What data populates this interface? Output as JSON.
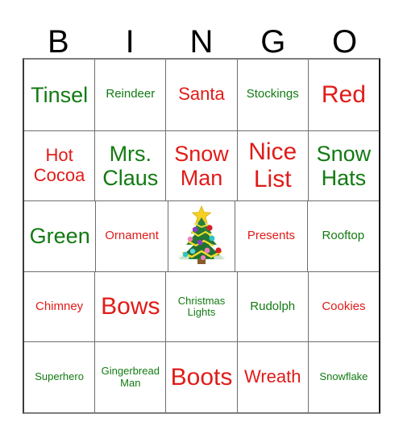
{
  "card": {
    "title": "BINGO",
    "headers": [
      "B",
      "I",
      "N",
      "G",
      "O"
    ],
    "header_color": "#000000",
    "grid_border_color": "#6e6e6e",
    "background_color": "#ffffff",
    "text_colors": {
      "green": "#127a12",
      "red": "#e01b18"
    },
    "rows": [
      [
        {
          "label": "Tinsel",
          "color": "green",
          "size": "lg"
        },
        {
          "label": "Reindeer",
          "color": "green",
          "size": "sm"
        },
        {
          "label": "Santa",
          "color": "red",
          "size": "md"
        },
        {
          "label": "Stockings",
          "color": "green",
          "size": "sm"
        },
        {
          "label": "Red",
          "color": "red",
          "size": "xl"
        }
      ],
      [
        {
          "label": "Hot\nCocoa",
          "color": "red",
          "size": "md"
        },
        {
          "label": "Mrs.\nClaus",
          "color": "green",
          "size": "lg"
        },
        {
          "label": "Snow\nMan",
          "color": "red",
          "size": "lg"
        },
        {
          "label": "Nice\nList",
          "color": "red",
          "size": "xl"
        },
        {
          "label": "Snow\nHats",
          "color": "green",
          "size": "lg"
        }
      ],
      [
        {
          "label": "Green",
          "color": "green",
          "size": "lg"
        },
        {
          "label": "Ornament",
          "color": "red",
          "size": "sm"
        },
        {
          "label": "",
          "color": "green",
          "size": "md",
          "icon": "christmas-tree-icon",
          "free_space": true
        },
        {
          "label": "Presents",
          "color": "red",
          "size": "sm"
        },
        {
          "label": "Rooftop",
          "color": "green",
          "size": "sm"
        }
      ],
      [
        {
          "label": "Chimney",
          "color": "red",
          "size": "sm"
        },
        {
          "label": "Bows",
          "color": "red",
          "size": "xl"
        },
        {
          "label": "Christmas\nLights",
          "color": "green",
          "size": "xs"
        },
        {
          "label": "Rudolph",
          "color": "green",
          "size": "sm"
        },
        {
          "label": "Cookies",
          "color": "red",
          "size": "sm"
        }
      ],
      [
        {
          "label": "Superhero",
          "color": "green",
          "size": "xs"
        },
        {
          "label": "Gingerbread\nMan",
          "color": "green",
          "size": "xs"
        },
        {
          "label": "Boots",
          "color": "red",
          "size": "xl"
        },
        {
          "label": "Wreath",
          "color": "red",
          "size": "md"
        },
        {
          "label": "Snowflake",
          "color": "green",
          "size": "xs"
        }
      ]
    ],
    "free_space": {
      "icon": "christmas-tree-icon",
      "star_color": "#f5d020",
      "foliage_color": "#1f7a33",
      "trunk_color": "#8a5a2b",
      "garland_color": "#f2e02a",
      "ornament_colors": [
        "#d81f26",
        "#8b3fc4",
        "#f07fb8",
        "#2bc6c6",
        "#5ad4e6"
      ]
    }
  }
}
